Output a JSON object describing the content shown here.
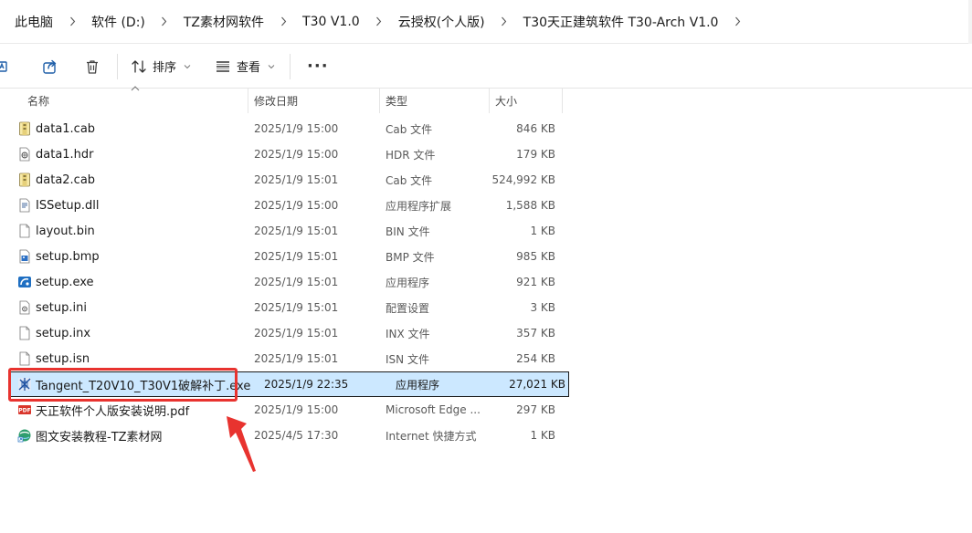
{
  "breadcrumb": [
    {
      "label": "此电脑"
    },
    {
      "label": "软件 (D:)"
    },
    {
      "label": "TZ素材网软件"
    },
    {
      "label": "T30 V1.0"
    },
    {
      "label": "云授权(个人版)"
    },
    {
      "label": "T30天正建筑软件 T30-Arch V1.0"
    }
  ],
  "toolbar": {
    "sort_label": "排序",
    "view_label": "查看",
    "more_label": "···"
  },
  "columns": {
    "name": "名称",
    "date": "修改日期",
    "type": "类型",
    "size": "大小"
  },
  "files": [
    {
      "name": "data1.cab",
      "date": "2025/1/9 15:00",
      "type": "Cab 文件",
      "size": "846 KB",
      "icon": "cab-file-icon"
    },
    {
      "name": "data1.hdr",
      "date": "2025/1/9 15:00",
      "type": "HDR 文件",
      "size": "179 KB",
      "icon": "hdr-file-icon"
    },
    {
      "name": "data2.cab",
      "date": "2025/1/9 15:01",
      "type": "Cab 文件",
      "size": "524,992 KB",
      "icon": "cab-file-icon"
    },
    {
      "name": "ISSetup.dll",
      "date": "2025/1/9 15:00",
      "type": "应用程序扩展",
      "size": "1,588 KB",
      "icon": "dll-file-icon"
    },
    {
      "name": "layout.bin",
      "date": "2025/1/9 15:01",
      "type": "BIN 文件",
      "size": "1 KB",
      "icon": "blank-file-icon"
    },
    {
      "name": "setup.bmp",
      "date": "2025/1/9 15:01",
      "type": "BMP 文件",
      "size": "985 KB",
      "icon": "image-file-icon"
    },
    {
      "name": "setup.exe",
      "date": "2025/1/9 15:01",
      "type": "应用程序",
      "size": "921 KB",
      "icon": "setup-exe-icon"
    },
    {
      "name": "setup.ini",
      "date": "2025/1/9 15:01",
      "type": "配置设置",
      "size": "3 KB",
      "icon": "ini-file-icon"
    },
    {
      "name": "setup.inx",
      "date": "2025/1/9 15:01",
      "type": "INX 文件",
      "size": "357 KB",
      "icon": "blank-file-icon"
    },
    {
      "name": "setup.isn",
      "date": "2025/1/9 15:01",
      "type": "ISN 文件",
      "size": "254 KB",
      "icon": "blank-file-icon"
    },
    {
      "name": "Tangent_T20V10_T30V1破解补丁.exe",
      "date": "2025/1/9 22:35",
      "type": "应用程序",
      "size": "27,021 KB",
      "icon": "tangent-exe-icon"
    },
    {
      "name": "天正软件个人版安装说明.pdf",
      "date": "2025/1/9 15:00",
      "type": "Microsoft Edge ...",
      "size": "297 KB",
      "icon": "pdf-file-icon"
    },
    {
      "name": "图文安装教程-TZ素材网",
      "date": "2025/4/5 17:30",
      "type": "Internet 快捷方式",
      "size": "1 KB",
      "icon": "url-shortcut-icon"
    }
  ],
  "selected_index": 10,
  "colors": {
    "selection": "#cce8ff",
    "annotation": "#e8332f"
  }
}
